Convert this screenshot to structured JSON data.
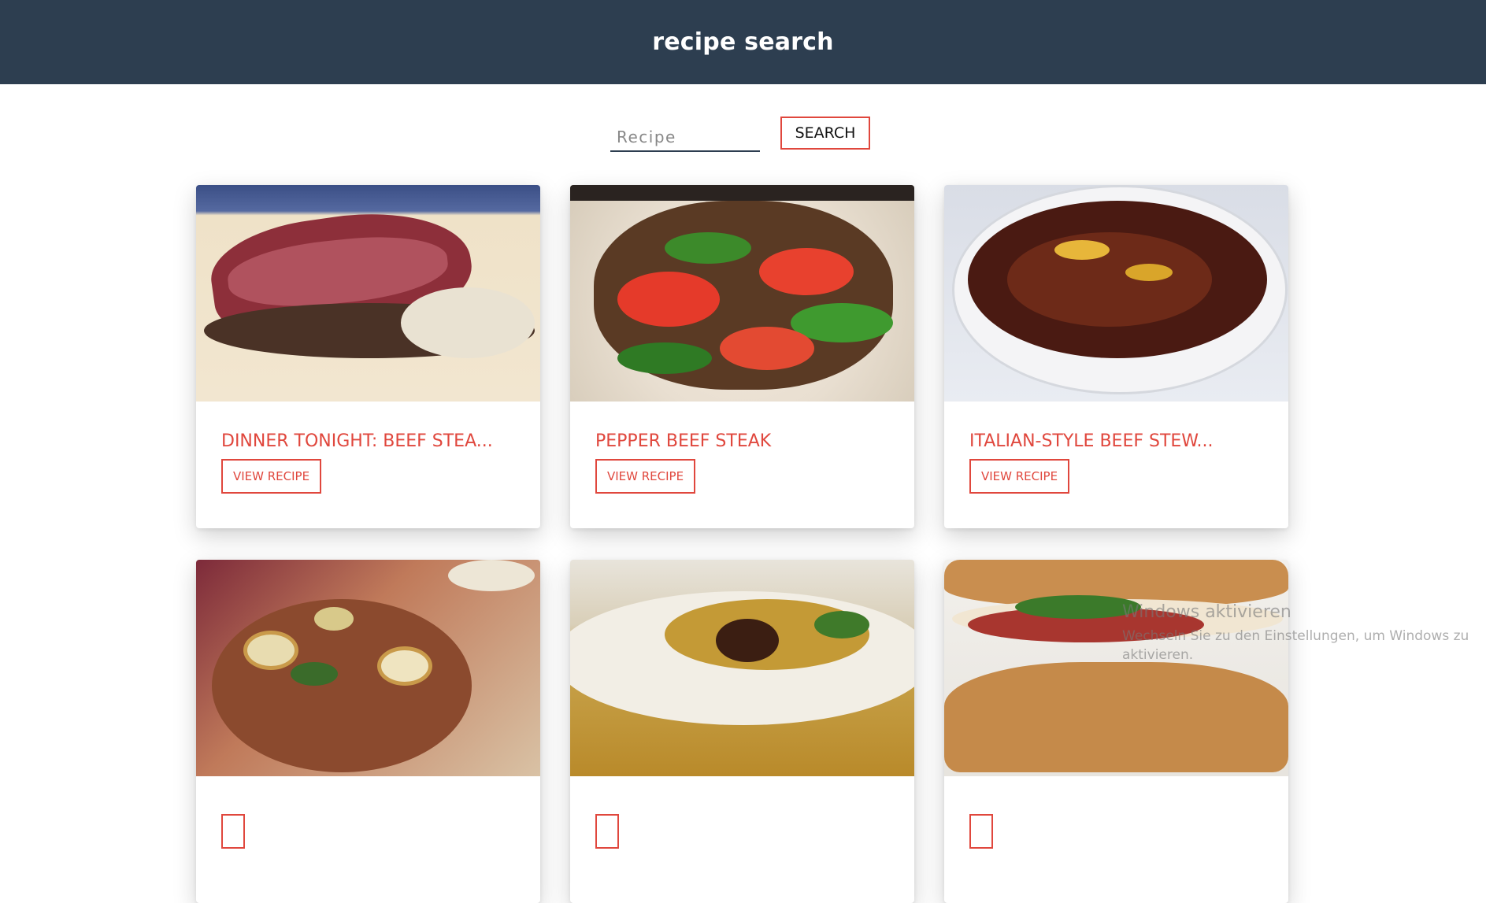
{
  "header": {
    "title": "recipe search"
  },
  "search": {
    "placeholder": "Recipe",
    "value": "",
    "button_label": "SEARCH"
  },
  "recipes": [
    {
      "title": "DINNER TONIGHT: BEEF STEA...",
      "button": "VIEW RECIPE"
    },
    {
      "title": "PEPPER BEEF STEAK",
      "button": "VIEW RECIPE"
    },
    {
      "title": "ITALIAN-STYLE BEEF STEW...",
      "button": "VIEW RECIPE"
    },
    {
      "title": "",
      "button": ""
    },
    {
      "title": "",
      "button": ""
    },
    {
      "title": "",
      "button": ""
    }
  ],
  "watermark": {
    "title": "Windows aktivieren",
    "line1": "Wechseln Sie zu den Einstellungen, um Windows zu",
    "line2": "aktivieren."
  },
  "colors": {
    "header_bg": "#2d3e50",
    "accent": "#e0473d"
  }
}
